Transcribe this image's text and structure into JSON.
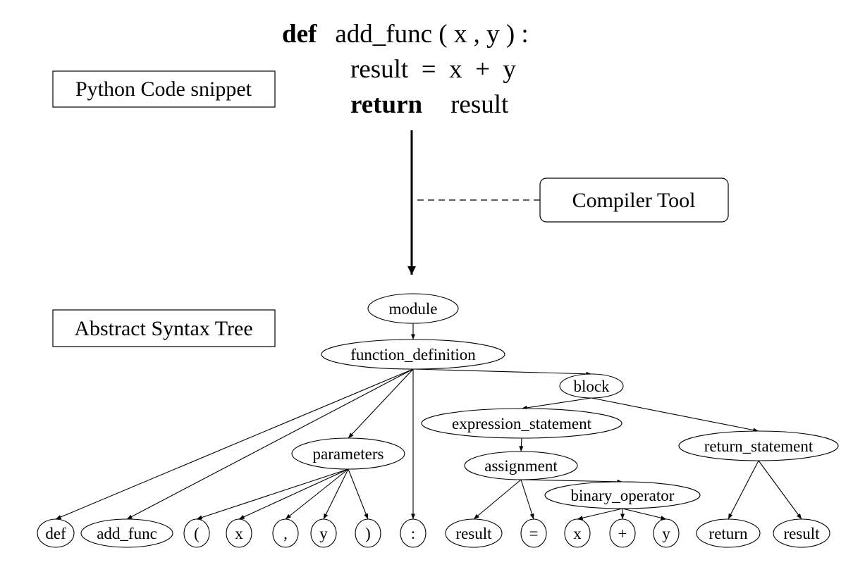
{
  "code": {
    "line1": {
      "keyword": "def",
      "rest": "add_func ( x ,  y ) :"
    },
    "line2": {
      "text": "result  =  x  +  y"
    },
    "line3": {
      "keyword": "return",
      "rest": "result"
    }
  },
  "labels": {
    "code_box": "Python Code snippet",
    "ast_box": "Abstract Syntax Tree",
    "tool_box": "Compiler Tool"
  },
  "tree": {
    "nodes": [
      {
        "id": "module",
        "label": "module",
        "parent": null
      },
      {
        "id": "function_definition",
        "label": "function_definition",
        "parent": "module"
      },
      {
        "id": "block",
        "label": "block",
        "parent": "function_definition"
      },
      {
        "id": "expression_statement",
        "label": "expression_statement",
        "parent": "block"
      },
      {
        "id": "return_statement",
        "label": "return_statement",
        "parent": "block"
      },
      {
        "id": "parameters",
        "label": "parameters",
        "parent": "function_definition"
      },
      {
        "id": "assignment",
        "label": "assignment",
        "parent": "expression_statement"
      },
      {
        "id": "binary_operator",
        "label": "binary_operator",
        "parent": "assignment"
      },
      {
        "id": "def",
        "label": "def",
        "parent": "function_definition"
      },
      {
        "id": "add_func",
        "label": "add_func",
        "parent": "function_definition"
      },
      {
        "id": "lparen",
        "label": "(",
        "parent": "parameters"
      },
      {
        "id": "px",
        "label": "x",
        "parent": "parameters"
      },
      {
        "id": "comma",
        "label": ",",
        "parent": "parameters"
      },
      {
        "id": "py",
        "label": "y",
        "parent": "parameters"
      },
      {
        "id": "rparen",
        "label": ")",
        "parent": "parameters"
      },
      {
        "id": "colon",
        "label": ":",
        "parent": "function_definition"
      },
      {
        "id": "result1",
        "label": "result",
        "parent": "assignment"
      },
      {
        "id": "eq",
        "label": "=",
        "parent": "assignment"
      },
      {
        "id": "bx",
        "label": "x",
        "parent": "binary_operator"
      },
      {
        "id": "plus",
        "label": "+",
        "parent": "binary_operator"
      },
      {
        "id": "by",
        "label": "y",
        "parent": "binary_operator"
      },
      {
        "id": "ret",
        "label": "return",
        "parent": "return_statement"
      },
      {
        "id": "result2",
        "label": "result",
        "parent": "return_statement"
      }
    ]
  }
}
